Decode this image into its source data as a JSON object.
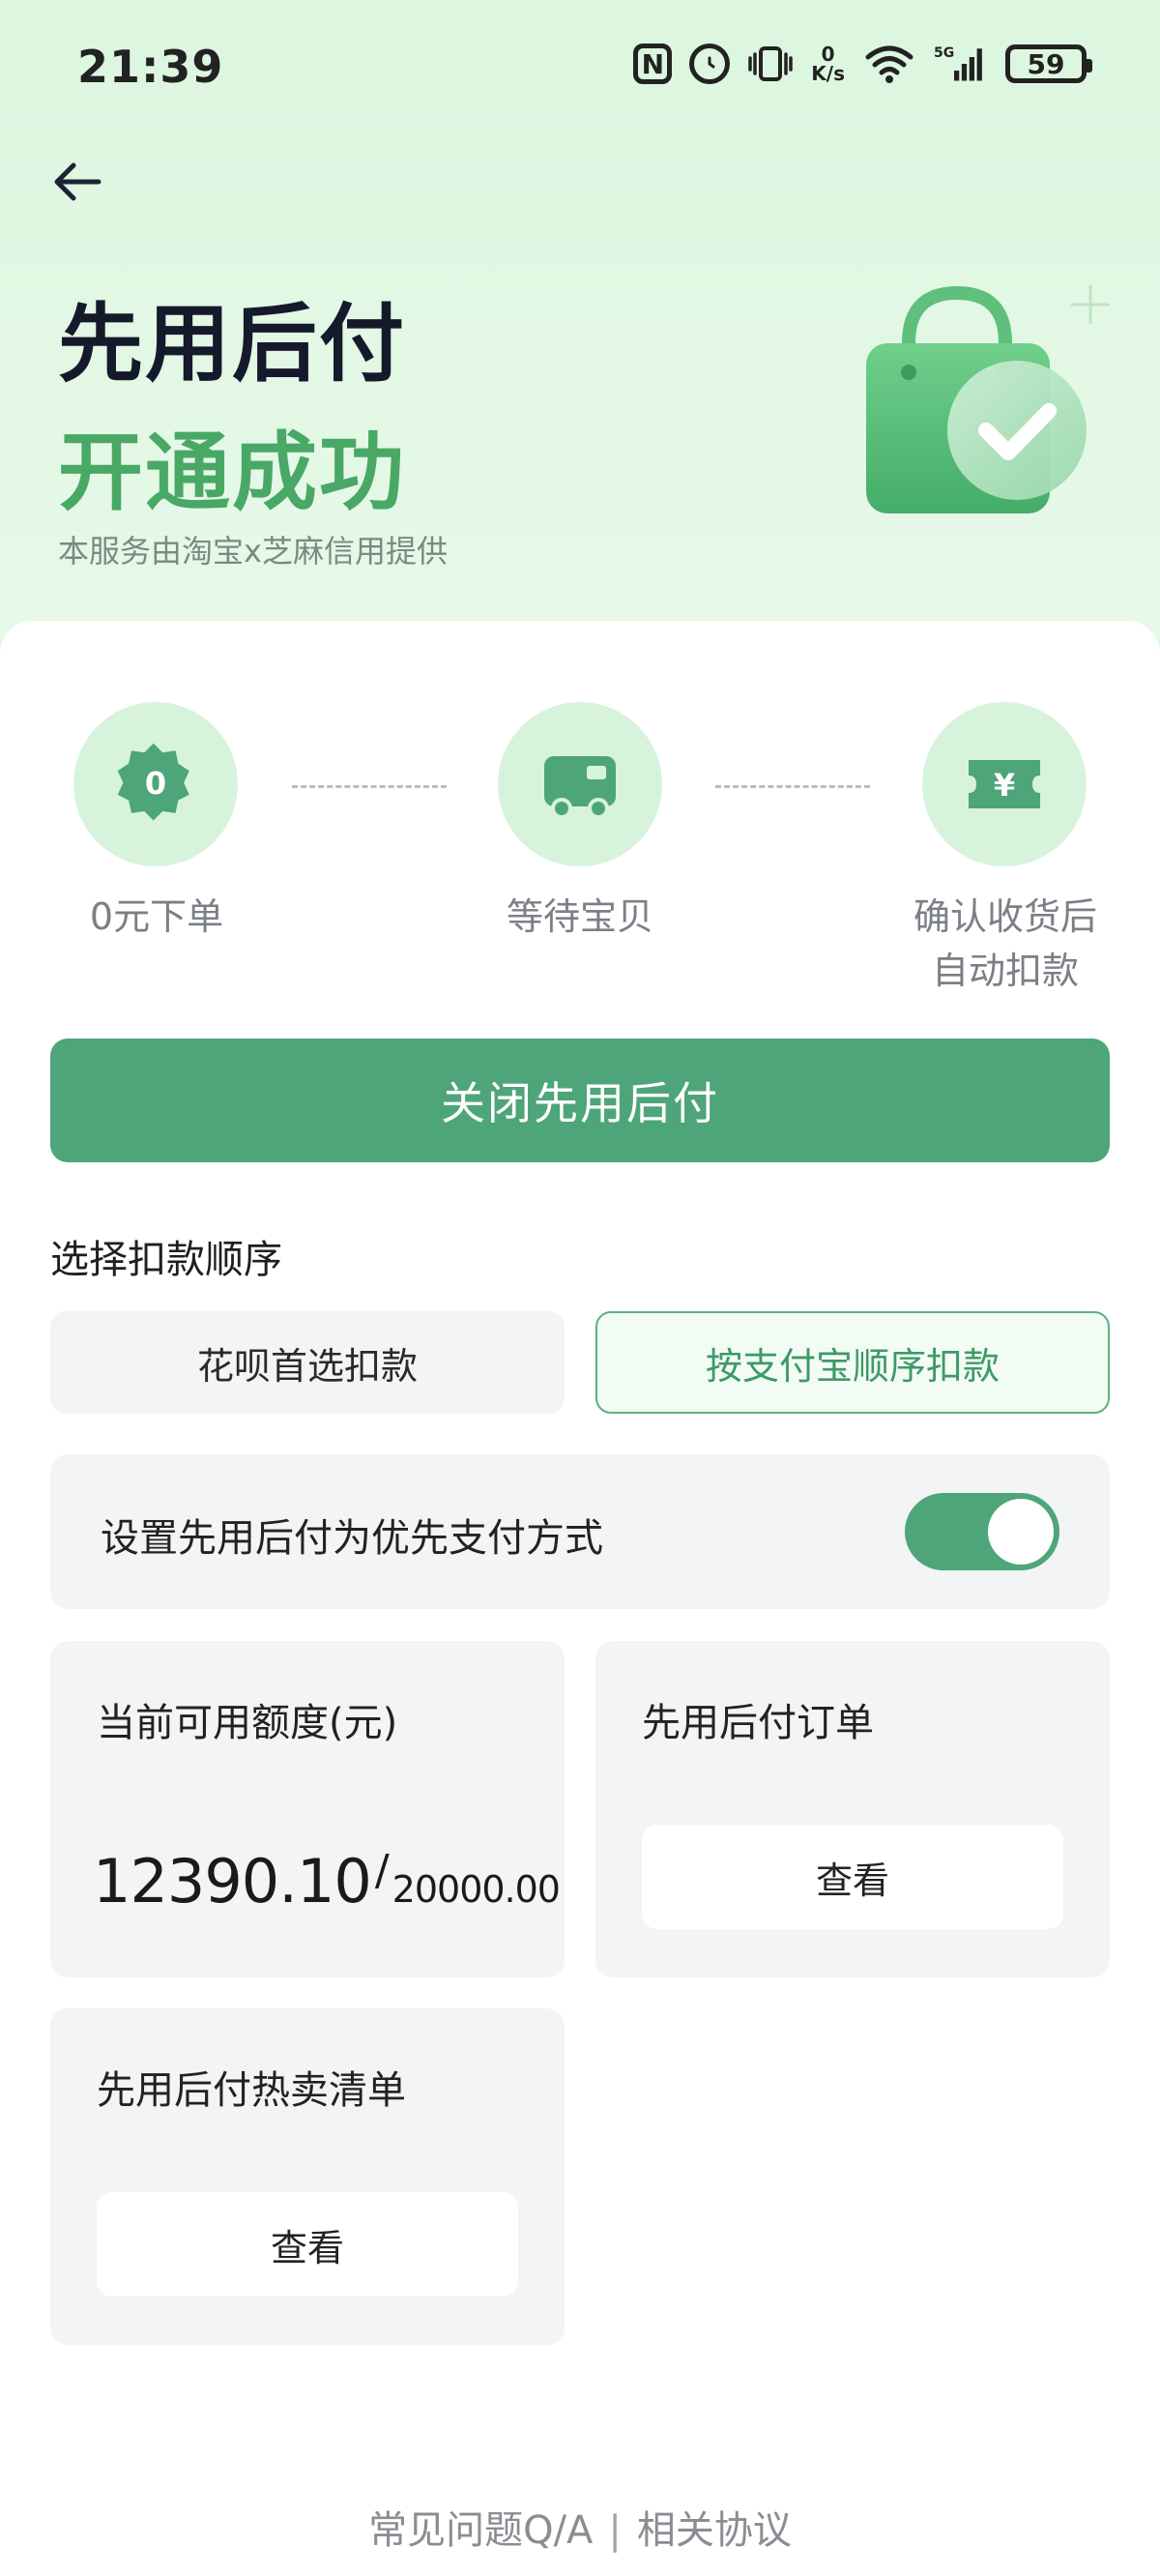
{
  "status_bar": {
    "time": "21:39",
    "nfc_glyph": "N",
    "net_speed_value": "0",
    "net_speed_unit": "K/s",
    "network_type": "5G",
    "battery": "59",
    "icons": [
      "nfc-icon",
      "alarm-icon",
      "vibrate-icon",
      "wifi-icon",
      "signal-icon",
      "battery-icon"
    ]
  },
  "header": {
    "title_line1": "先用后付",
    "title_line2": "开通成功",
    "provider_text": "本服务由淘宝x芝麻信用提供",
    "back_icon": "arrow-left-icon",
    "illustration": "shopping-bag-check-icon"
  },
  "steps": [
    {
      "icon": "zero-badge-icon",
      "glyph": "0",
      "label": "0元下单"
    },
    {
      "icon": "truck-icon",
      "label": "等待宝贝"
    },
    {
      "icon": "yuan-ticket-icon",
      "glyph": "¥",
      "label_line1": "确认收货后",
      "label_line2": "自动扣款"
    }
  ],
  "close_button_label": "关闭先用后付",
  "deduction_order": {
    "title": "选择扣款顺序",
    "options": [
      {
        "label": "花呗首选扣款",
        "selected": false
      },
      {
        "label": "按支付宝顺序扣款",
        "selected": true
      }
    ]
  },
  "preference": {
    "label": "设置先用后付为优先支付方式",
    "enabled": true
  },
  "quota_tile": {
    "title": "当前可用额度(元)",
    "available": "12390.10",
    "separator": "/",
    "total": "20000.00"
  },
  "orders_tile": {
    "title": "先用后付订单",
    "button_label": "查看"
  },
  "hot_list_tile": {
    "title": "先用后付热卖清单",
    "button_label": "查看"
  },
  "footer": {
    "faq_link": "常见问题Q/A",
    "separator": "|",
    "agreement_link": "相关协议"
  },
  "colors": {
    "brand_green": "#4ea57a",
    "title_green": "#4aa867",
    "hero_bg": "#dcf6df",
    "step_circle": "#d7f3dc"
  }
}
